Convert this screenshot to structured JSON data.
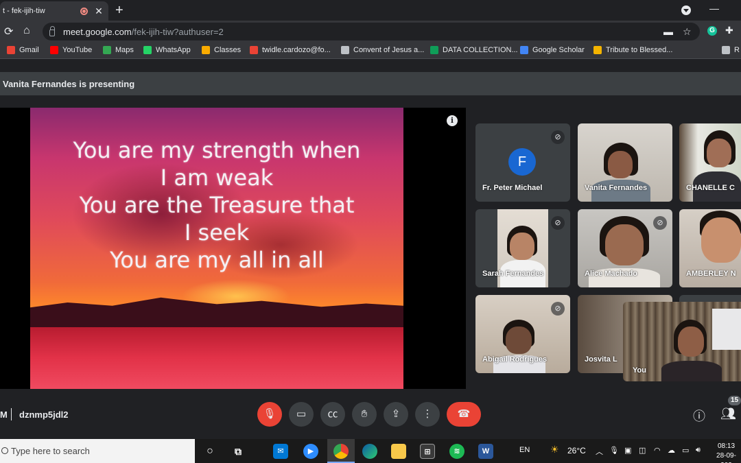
{
  "browser": {
    "tab_title": "t - fek-ijih-tiw",
    "tab_close": "✕",
    "new_tab": "+",
    "minimize": "—",
    "url_host": "meet.google.com",
    "url_path": "/fek-ijih-tiw?authuser=2",
    "ext_g": "G"
  },
  "bookmarks": [
    {
      "label": "Gmail",
      "icon": "gmail-icon",
      "color": "#ea4335"
    },
    {
      "label": "YouTube",
      "icon": "youtube-icon",
      "color": "#ff0000"
    },
    {
      "label": "Maps",
      "icon": "maps-pin-icon",
      "color": "#34a853"
    },
    {
      "label": "WhatsApp",
      "icon": "whatsapp-icon",
      "color": "#25d366"
    },
    {
      "label": "Classes",
      "icon": "classroom-icon",
      "color": "#f9ab00"
    },
    {
      "label": "twidle.cardozo@fo...",
      "icon": "gmail-icon",
      "color": "#ea4335"
    },
    {
      "label": "Convent of Jesus a...",
      "icon": "page-icon",
      "color": "#bdc1c6"
    },
    {
      "label": "DATA COLLECTION...",
      "icon": "sheets-icon",
      "color": "#0f9d58"
    },
    {
      "label": "Google Scholar",
      "icon": "scholar-icon",
      "color": "#4285f4"
    },
    {
      "label": "Tribute to Blessed...",
      "icon": "slides-icon",
      "color": "#f4b400"
    },
    {
      "label": "R",
      "icon": "reading-list-icon",
      "color": "#bdc1c6"
    }
  ],
  "meet": {
    "presenting_text": "Vanita Fernandes is presenting",
    "slide_lines": [
      "You are my strength when",
      "I am weak",
      "You are the Treasure that",
      "I seek",
      "You are my all in all"
    ],
    "info": "i",
    "participants": [
      {
        "name": "Fr. Peter Michael",
        "avatar_letter": "F",
        "muted": true
      },
      {
        "name": "Vanita Fernandes",
        "muted": false
      },
      {
        "name": "CHANELLE C",
        "muted": false
      },
      {
        "name": "Sarah Fernandes",
        "muted": true
      },
      {
        "name": "Alice Machado",
        "muted": true
      },
      {
        "name": "AMBERLEY N",
        "muted": false
      },
      {
        "name": "Abigail Rodrigues",
        "muted": true
      },
      {
        "name": "Josvita L",
        "muted": false
      }
    ],
    "self_label": "You",
    "time_fragment": "M",
    "meeting_code": "dznmp5jdl2",
    "people_count": "15"
  },
  "taskbar": {
    "search_placeholder": "Type here to search",
    "language": "EN",
    "temperature": "26°C",
    "time": "08:13",
    "date": "28-09-202"
  }
}
